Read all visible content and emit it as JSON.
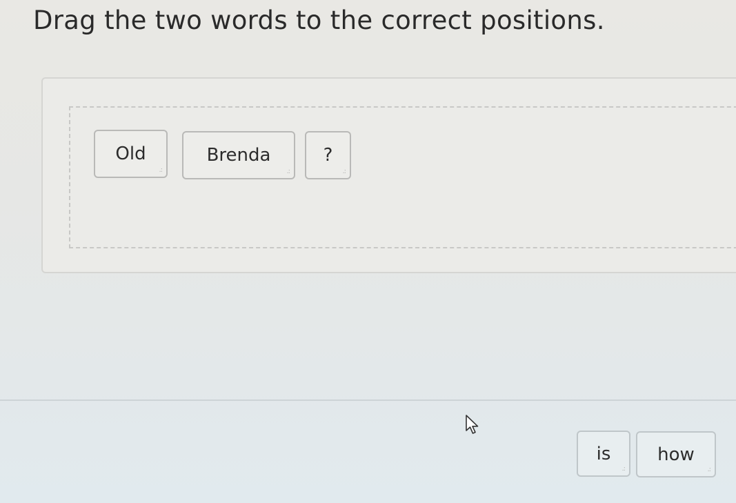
{
  "instruction": "Drag the two words to the correct positions.",
  "answer_area": {
    "tiles": [
      {
        "label": "Old"
      },
      {
        "label": "Brenda"
      },
      {
        "label": "?"
      }
    ]
  },
  "word_bank": {
    "tiles": [
      {
        "label": "is"
      },
      {
        "label": "how"
      }
    ]
  },
  "icons": {
    "drag_handle": "grip-dots-icon",
    "cursor": "mouse-pointer-icon"
  },
  "colors": {
    "tile_border": "#b9b9b7",
    "text": "#2c2c2c"
  }
}
